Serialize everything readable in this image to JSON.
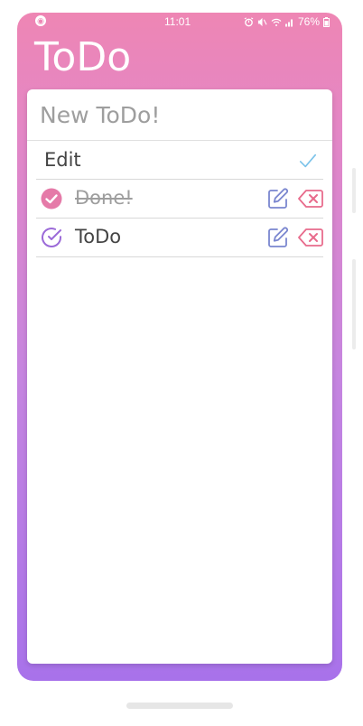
{
  "status_bar": {
    "time": "11:01",
    "battery": "76%",
    "left_icon": "notification-icon",
    "icons": [
      "alarm-icon",
      "mute-icon",
      "wifi-icon",
      "signal-icon",
      "battery-icon"
    ]
  },
  "app": {
    "title": "ToDo"
  },
  "new_todo": {
    "placeholder": "New ToDo!",
    "value": ""
  },
  "edit_row": {
    "label": "Edit",
    "icon": "checkmark-icon",
    "icon_color": "#7cc3ea"
  },
  "todos": [
    {
      "text": "Done!",
      "completed": true,
      "status_icon": "check-circle-filled-icon",
      "edit_icon": "edit-icon",
      "delete_icon": "backspace-icon"
    },
    {
      "text": "ToDo",
      "completed": false,
      "status_icon": "check-circle-outline-icon",
      "edit_icon": "edit-icon",
      "delete_icon": "backspace-icon"
    }
  ],
  "colors": {
    "gradient_top": "#ee86b4",
    "gradient_bottom": "#a872ea",
    "done_icon": "#e57aa8",
    "todo_icon": "#9b6ad8",
    "edit_icon": "#7a86cf",
    "delete_icon": "#e86b8c"
  }
}
